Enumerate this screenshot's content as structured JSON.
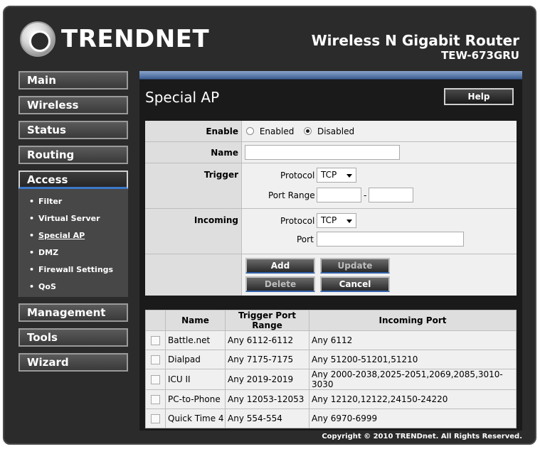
{
  "brand": {
    "logo_text": "TRENDNET",
    "product_title": "Wireless N Gigabit Router",
    "model": "TEW-673GRU"
  },
  "nav": {
    "main": "Main",
    "wireless": "Wireless",
    "status": "Status",
    "routing": "Routing",
    "access": "Access",
    "management": "Management",
    "tools": "Tools",
    "wizard": "Wizard",
    "access_sub": [
      "Filter",
      "Virtual Server",
      "Special AP",
      "DMZ",
      "Firewall Settings",
      "QoS"
    ]
  },
  "page": {
    "title": "Special AP",
    "help": "Help"
  },
  "form": {
    "enable_label": "Enable",
    "enabled": "Enabled",
    "disabled": "Disabled",
    "selected": "Disabled",
    "name_label": "Name",
    "name_value": "",
    "trigger_label": "Trigger",
    "protocol_label": "Protocol",
    "trigger_protocol": "TCP",
    "port_range_label": "Port Range",
    "range_sep": "-",
    "trigger_start": "",
    "trigger_end": "",
    "incoming_label": "Incoming",
    "incoming_protocol": "TCP",
    "port_label": "Port",
    "incoming_port": "",
    "add": "Add",
    "update": "Update",
    "delete": "Delete",
    "cancel": "Cancel"
  },
  "table": {
    "headers": [
      "Name",
      "Trigger Port Range",
      "Incoming Port"
    ],
    "rows": [
      {
        "name": "Battle.net",
        "trigger": "Any 6112-6112",
        "incoming": "Any 6112"
      },
      {
        "name": "Dialpad",
        "trigger": "Any 7175-7175",
        "incoming": "Any 51200-51201,51210"
      },
      {
        "name": "ICU II",
        "trigger": "Any 2019-2019",
        "incoming": "Any 2000-2038,2025-2051,2069,2085,3010-3030"
      },
      {
        "name": "PC-to-Phone",
        "trigger": "Any 12053-12053",
        "incoming": "Any 12120,12122,24150-24220"
      },
      {
        "name": "Quick Time 4",
        "trigger": "Any 554-554",
        "incoming": "Any 6970-6999"
      }
    ]
  },
  "footer": {
    "copyright": "Copyright © 2010 TRENDnet. All Rights Reserved."
  }
}
